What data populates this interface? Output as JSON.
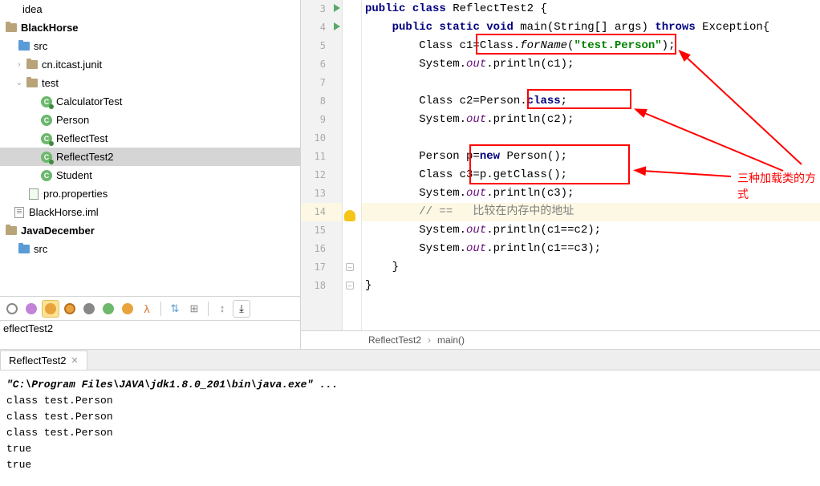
{
  "project_tree": {
    "idea_label": "idea",
    "root": "BlackHorse",
    "src": "src",
    "pkg_junit": "cn.itcast.junit",
    "pkg_test": "test",
    "classes": {
      "calculator": "CalculatorTest",
      "person": "Person",
      "reflect": "ReflectTest",
      "reflect2": "ReflectTest2",
      "student": "Student"
    },
    "prop_file": "pro.properties",
    "iml_file": "BlackHorse.iml",
    "java_dec": "JavaDecember",
    "src2": "src"
  },
  "gutter": [
    "3",
    "4",
    "5",
    "6",
    "7",
    "8",
    "9",
    "10",
    "11",
    "12",
    "13",
    "14",
    "15",
    "16",
    "17",
    "18"
  ],
  "code": {
    "l3_a": "public",
    "l3_b": "class",
    "l3_c": " ReflectTest2 {",
    "l4_a": "public",
    "l4_b": "static",
    "l4_c": "void",
    "l4_d": " main(String[] args) ",
    "l4_e": "throws",
    "l4_f": " Exception{",
    "l5_a": "        Class c1=Class.",
    "l5_b": "forName",
    "l5_c": "(",
    "l5_d": "\"test.Person\"",
    "l5_e": ");",
    "l6_a": "        System.",
    "l6_b": "out",
    "l6_c": ".println(c1);",
    "l8_a": "        Class c2=Person.",
    "l8_b": "class",
    "l8_c": ";",
    "l9_a": "        System.",
    "l9_b": "out",
    "l9_c": ".println(c2);",
    "l11_a": "        Person p=",
    "l11_b": "new",
    "l11_c": " Person();",
    "l12_a": "        Class c3=p.getClass();",
    "l13_a": "        System.",
    "l13_b": "out",
    "l13_c": ".println(c3);",
    "l14_a": "        // ==   比较在内存中的地址",
    "l15_a": "        System.",
    "l15_b": "out",
    "l15_c": ".println(c1==c2);",
    "l16_a": "        System.",
    "l16_b": "out",
    "l16_c": ".println(c1==c3);",
    "l17": "    }",
    "l18": "}"
  },
  "annotation_label": "三种加载类的方式",
  "breadcrumb": {
    "file": "ReflectTest2",
    "method": "main()"
  },
  "truncated": "eflectTest2",
  "console": {
    "tab": "ReflectTest2",
    "cmd": "\"C:\\Program Files\\JAVA\\jdk1.8.0_201\\bin\\java.exe\" ...",
    "out1": "class test.Person",
    "out2": "class test.Person",
    "out3": "class test.Person",
    "out4": "true",
    "out5": "true"
  }
}
